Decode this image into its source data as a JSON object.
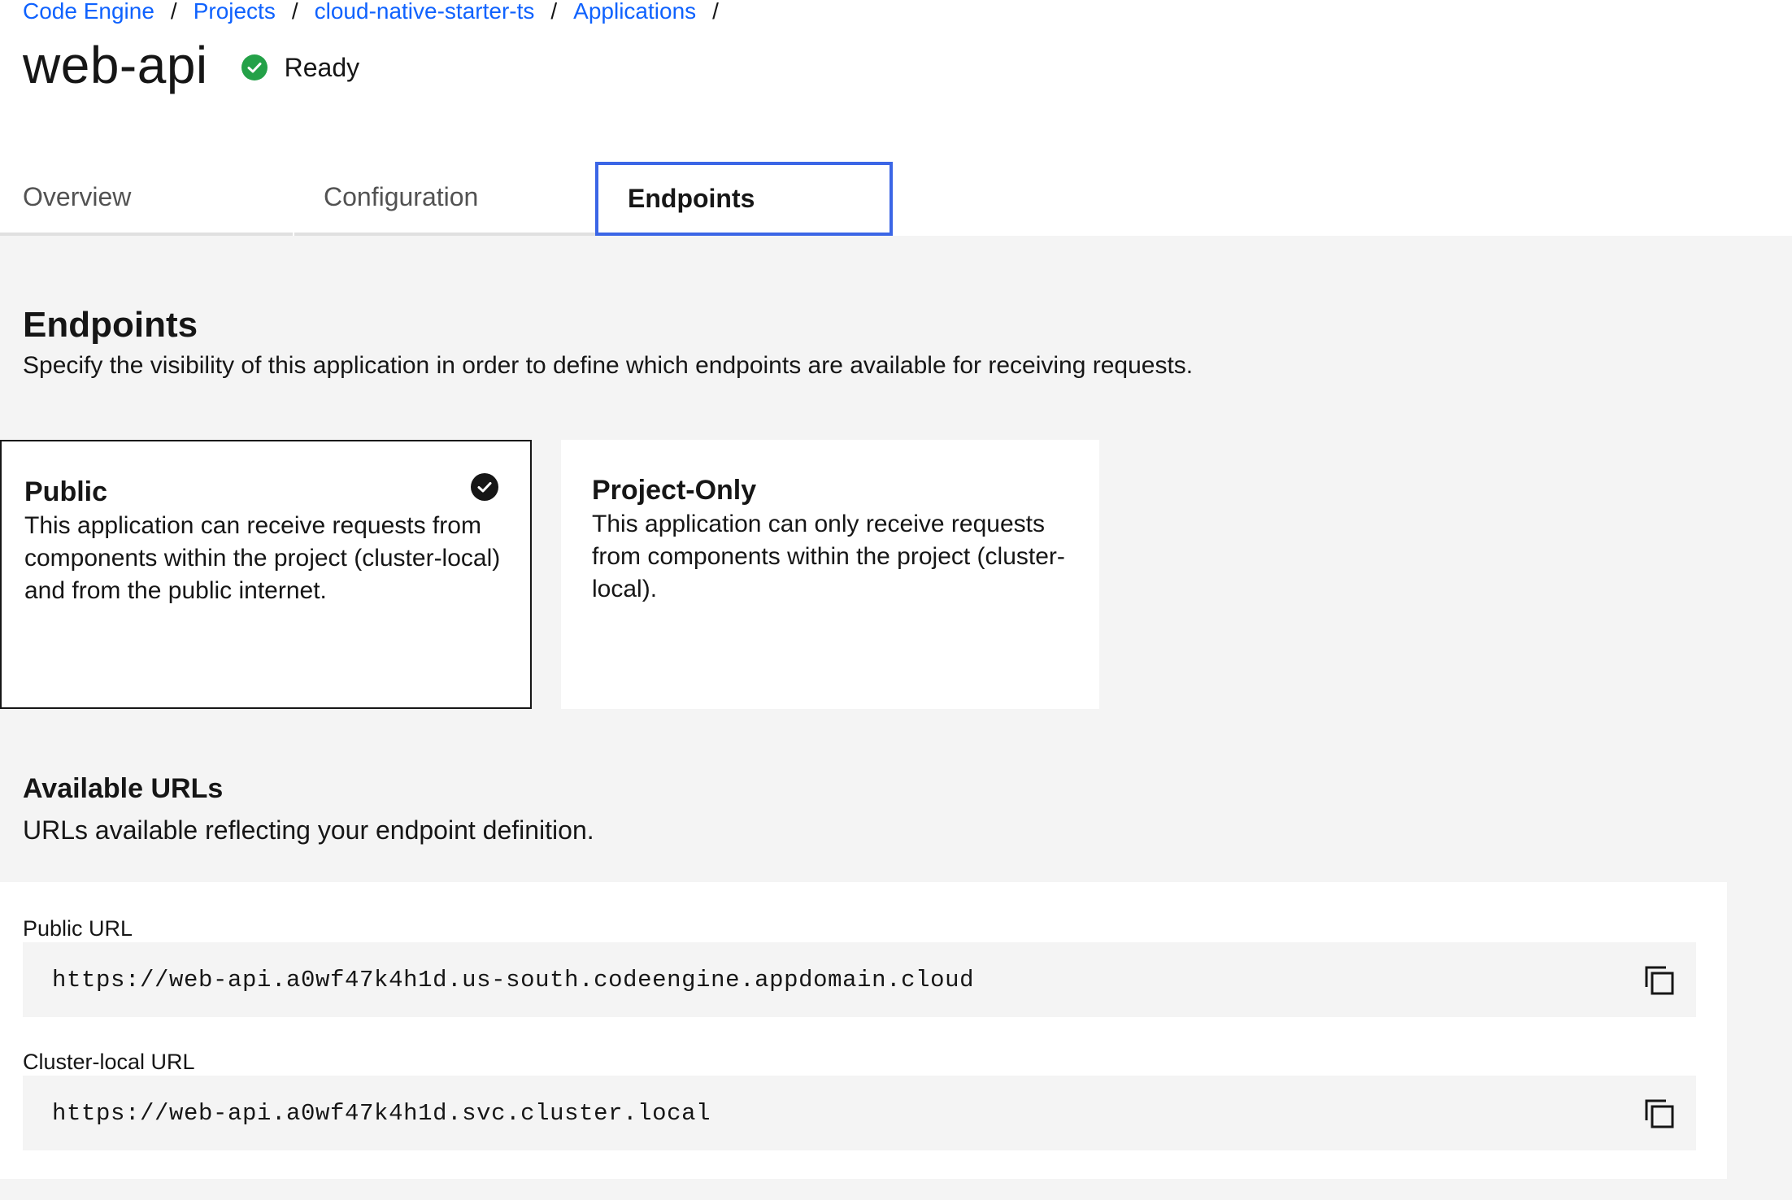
{
  "breadcrumb": {
    "items": [
      "Code Engine",
      "Projects",
      "cloud-native-starter-ts",
      "Applications"
    ],
    "separator": "/"
  },
  "header": {
    "title": "web-api",
    "status": "Ready",
    "status_icon": "checkmark-filled-icon",
    "status_color": "#24a148"
  },
  "tabs": [
    {
      "label": "Overview",
      "selected": false
    },
    {
      "label": "Configuration",
      "selected": false
    },
    {
      "label": "Endpoints",
      "selected": true
    }
  ],
  "endpoints": {
    "title": "Endpoints",
    "description": "Specify the visibility of this application in order to define which endpoints are available for receiving requests.",
    "options": [
      {
        "title": "Public",
        "description": "This application can receive requests from components within the project (cluster-local) and from the public internet.",
        "selected": true
      },
      {
        "title": "Project-Only",
        "description": "This application can only receive requests from components within the project (cluster-local).",
        "selected": false
      }
    ]
  },
  "urls": {
    "title": "Available URLs",
    "description": "URLs available reflecting your endpoint definition.",
    "items": [
      {
        "label": "Public URL",
        "value": "https://web-api.a0wf47k4h1d.us-south.codeengine.appdomain.cloud"
      },
      {
        "label": "Cluster-local URL",
        "value": "https://web-api.a0wf47k4h1d.svc.cluster.local"
      }
    ]
  },
  "colors": {
    "link": "#0f62fe",
    "tab_focus_border": "#3b66e6",
    "background": "#f4f4f4"
  }
}
